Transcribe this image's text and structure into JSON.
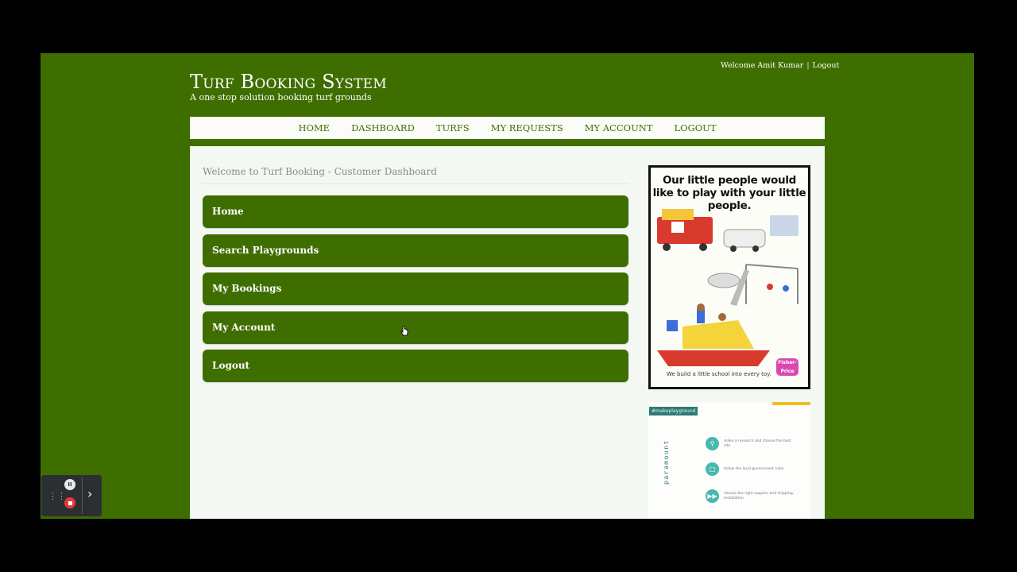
{
  "header": {
    "title": "Turf Booking System",
    "tagline": "A one stop solution booking turf grounds",
    "welcome": "Welcome Amit Kumar",
    "logout": "Logout"
  },
  "nav": [
    "HOME",
    "DASHBOARD",
    "TURFS",
    "MY REQUESTS",
    "MY ACCOUNT",
    "LOGOUT"
  ],
  "main": {
    "heading": "Welcome to Turf Booking - Customer Dashboard",
    "menu": [
      "Home",
      "Search Playgrounds",
      "My Bookings",
      "My Account",
      "Logout"
    ]
  },
  "ads": {
    "ad1": {
      "headline": "Our little people would like to play with your little people.",
      "footer": "We build a little school into every toy.",
      "badge": "Fisher-Price"
    },
    "ad2": {
      "tag": "#makeplayground",
      "brand": "paramount",
      "steps": [
        "make a research and choose the best site",
        "follow the local government rules",
        "choose the right supplier and shipping, installation"
      ]
    }
  },
  "colors": {
    "brand_green": "#3f6e00",
    "content_bg": "#f4f8f2",
    "nav_bg": "#fbfcf8"
  },
  "recorder": {
    "icons": [
      "drag-handle-icon",
      "pause-icon",
      "stop-icon",
      "chevron-right-icon"
    ]
  }
}
